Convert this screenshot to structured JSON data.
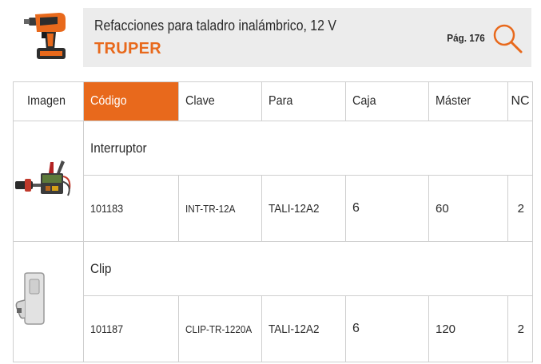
{
  "header": {
    "title": "Refacciones para taladro inalámbrico, 12 V",
    "brand": "TRUPER",
    "page_label": "Pág. 176"
  },
  "table": {
    "columns": [
      "Imagen",
      "Código",
      "Clave",
      "Para",
      "Caja",
      "Máster",
      "NC"
    ],
    "active_column": "Código",
    "groups": [
      {
        "name": "Interruptor",
        "image": "switch-part-image",
        "row": {
          "codigo": "101183",
          "clave": "INT-TR-12A",
          "para": "TALI-12A2",
          "caja": "6",
          "master": "60",
          "nc": "2"
        }
      },
      {
        "name": "Clip",
        "image": "belt-clip-image",
        "row": {
          "codigo": "101187",
          "clave": "CLIP-TR-1220A",
          "para": "TALI-12A2",
          "caja": "6",
          "master": "120",
          "nc": "2"
        }
      }
    ]
  },
  "colors": {
    "accent": "#e8691c",
    "header_bg": "#ececec",
    "border": "#cfcfcf"
  }
}
